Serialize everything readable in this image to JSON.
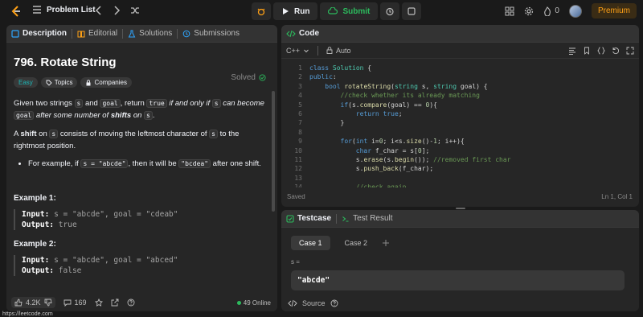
{
  "topbar": {
    "problem_list_label": "Problem List",
    "run_label": "Run",
    "submit_label": "Submit",
    "notification_count": "0",
    "premium_label": "Premium"
  },
  "left_panel": {
    "tabs": [
      {
        "label": "Description"
      },
      {
        "label": "Editorial"
      },
      {
        "label": "Solutions"
      },
      {
        "label": "Submissions"
      }
    ],
    "title": "796. Rotate String",
    "status": "Solved",
    "chips": {
      "difficulty": "Easy",
      "topics": "Topics",
      "companies": "Companies"
    },
    "statement": {
      "p1_a": "Given two strings ",
      "s": "s",
      "p1_b": " and ",
      "goal": "goal",
      "p1_c": ", return ",
      "true_kw": "true",
      "p1_d": " if and only if ",
      "p1_e": " can become ",
      "p1_f": " after some number of ",
      "shifts": "shifts",
      "p1_g": " on ",
      "p1_end": ".",
      "p2_a": "A ",
      "shift": "shift",
      "p2_b": " on ",
      "p2_c": " consists of moving the leftmost character of ",
      "p2_d": " to the rightmost position.",
      "bullet_a": "For example, if ",
      "bullet_code1": "s = \"abcde\"",
      "bullet_b": ", then it will be ",
      "bullet_code2": "\"bcdea\"",
      "bullet_c": " after one shift."
    },
    "examples": [
      {
        "heading": "Example 1:",
        "input_label": "Input:",
        "input": "s = \"abcde\", goal = \"cdeab\"",
        "output_label": "Output:",
        "output": "true"
      },
      {
        "heading": "Example 2:",
        "input_label": "Input:",
        "input": "s = \"abcde\", goal = \"abced\"",
        "output_label": "Output:",
        "output": "false"
      }
    ],
    "footer": {
      "likes": "4.2K",
      "comments": "169",
      "online": "49 Online"
    },
    "status_url": "https://leetcode.com"
  },
  "code_panel": {
    "title": "Code",
    "language": "C++",
    "mode": "Auto",
    "line_numbers": [
      "1",
      "2",
      "3",
      "4",
      "5",
      "6",
      "7",
      "8",
      "9",
      "10",
      "11",
      "12",
      "13",
      "14"
    ],
    "saved": "Saved",
    "cursor": "Ln 1, Col 1"
  },
  "testcase_panel": {
    "tab_testcase": "Testcase",
    "tab_result": "Test Result",
    "cases": [
      "Case 1",
      "Case 2"
    ],
    "param_label": "s =",
    "param_value": "\"abcde\"",
    "source_label": "Source"
  }
}
